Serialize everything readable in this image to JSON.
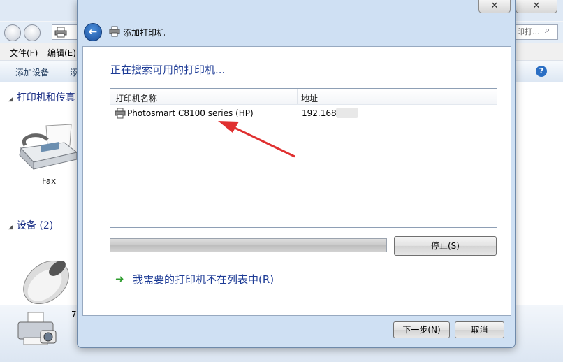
{
  "background_window": {
    "close_glyph": "✕",
    "search_placeholder": "印打...",
    "menu": [
      "文件(F)",
      "编辑(E)"
    ],
    "commands": [
      "添加设备",
      "添"
    ],
    "groups": [
      {
        "label": "打印机和传真"
      },
      {
        "label": "设备 (2)"
      }
    ],
    "devices": [
      {
        "label": "Fax",
        "icon": "fax-icon"
      },
      {
        "label": "",
        "icon": "mouse-icon"
      }
    ],
    "details_name": "7",
    "details_icon": "printer-camera-icon"
  },
  "dialog": {
    "title": "添加打印机",
    "close_glyph": "✕",
    "heading": "正在搜索可用的打印机...",
    "columns": {
      "name": "打印机名称",
      "address": "地址"
    },
    "printers": [
      {
        "name": "Photosmart C8100 series (HP)",
        "address": "192.168"
      }
    ],
    "progress": 1.0,
    "stop_button": "停止(S)",
    "not_listed_link": "我需要的打印机不在列表中(R)",
    "next_button": "下一步(N)",
    "cancel_button": "取消"
  },
  "colors": {
    "heading": "#1e3c96",
    "annotation_arrow": "#e03030",
    "link_arrow": "#2f9d2f"
  }
}
